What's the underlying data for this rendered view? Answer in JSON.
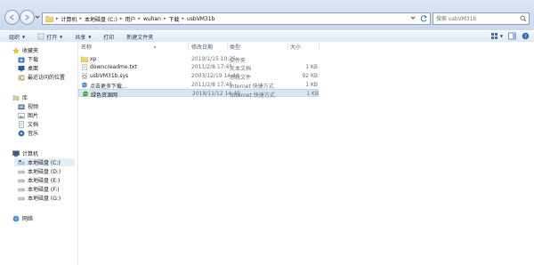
{
  "breadcrumbs": [
    "计算机",
    "本地磁盘 (C:)",
    "用户",
    "wuhan",
    "下载",
    "usbVM31b"
  ],
  "search": {
    "placeholder": "搜索 usbVM31b"
  },
  "toolbar": {
    "organize": "组织",
    "open": "打开",
    "share": "共享",
    "print": "打印",
    "new_folder": "新建文件夹"
  },
  "nav": {
    "favorites": "收藏夹",
    "favorites_items": [
      "下载",
      "桌面",
      "最近访问的位置"
    ],
    "libraries": "库",
    "libraries_items": [
      "视频",
      "图片",
      "文档",
      "音乐"
    ],
    "computer": "计算机",
    "drives": [
      "本地磁盘 (C:)",
      "本地磁盘 (D:)",
      "本地磁盘 (E:)",
      "本地磁盘 (F:)",
      "本地磁盘 (G:)"
    ],
    "network": "网络"
  },
  "columns": {
    "name": "名称",
    "date": "修改日期",
    "type": "类型",
    "size": "大小"
  },
  "files": [
    {
      "name": "xp",
      "date": "2019/1/15 10:25",
      "type": "文件夹",
      "size": "",
      "icon": "folder-icon"
    },
    {
      "name": "downcreadme.txt",
      "date": "2011/2/8 17:45",
      "type": "文本文档",
      "size": "1 KB",
      "icon": "text-file-icon"
    },
    {
      "name": "usbVM31b.sys",
      "date": "2003/12/19 14:40",
      "type": "系统文件",
      "size": "92 KB",
      "icon": "system-file-icon"
    },
    {
      "name": "点击更多下载...",
      "date": "2011/2/8 17:45",
      "type": "Internet 快捷方式",
      "size": "1 KB",
      "icon": "internet-shortcut-icon"
    },
    {
      "name": "绿色资源网",
      "date": "2018/11/12 14:49",
      "type": "Internet 快捷方式",
      "size": "1 KB",
      "icon": "internet-shortcut-icon"
    }
  ]
}
